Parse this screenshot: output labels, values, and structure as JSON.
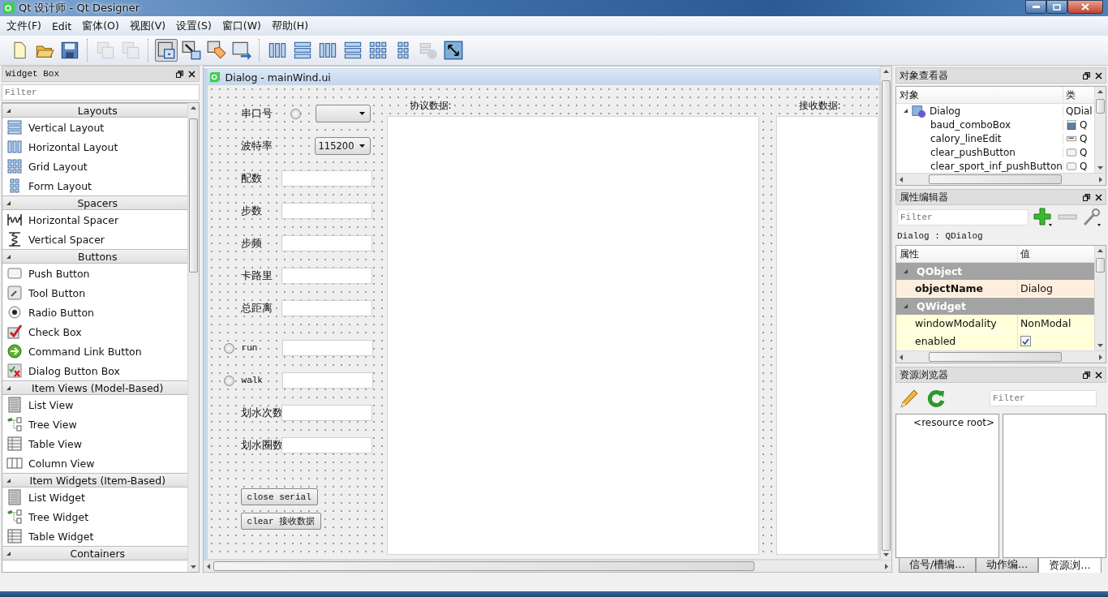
{
  "window": {
    "title": "Qt 设计师 - Qt Designer"
  },
  "menu": [
    "文件(F)",
    "Edit",
    "窗体(O)",
    "视图(V)",
    "设置(S)",
    "窗口(W)",
    "帮助(H)"
  ],
  "toolbar": [
    [
      {
        "kind": "new",
        "disabled": false,
        "selected": false
      },
      {
        "kind": "open",
        "disabled": false,
        "selected": false
      },
      {
        "kind": "save",
        "disabled": false,
        "selected": false
      }
    ],
    [
      {
        "kind": "front",
        "disabled": true,
        "selected": false
      },
      {
        "kind": "back",
        "disabled": true,
        "selected": false
      }
    ],
    [
      {
        "kind": "edit",
        "disabled": false,
        "selected": true
      },
      {
        "kind": "signals",
        "disabled": false,
        "selected": false
      },
      {
        "kind": "buddy",
        "disabled": false,
        "selected": false
      },
      {
        "kind": "taborder",
        "disabled": false,
        "selected": false
      }
    ],
    [
      {
        "kind": "hlayout",
        "disabled": false,
        "selected": false
      },
      {
        "kind": "vlayout",
        "disabled": false,
        "selected": false
      },
      {
        "kind": "hsplit",
        "disabled": false,
        "selected": false
      },
      {
        "kind": "vsplit",
        "disabled": false,
        "selected": false
      },
      {
        "kind": "grid",
        "disabled": false,
        "selected": false
      },
      {
        "kind": "form",
        "disabled": false,
        "selected": false
      },
      {
        "kind": "break",
        "disabled": true,
        "selected": false
      },
      {
        "kind": "adjust",
        "disabled": false,
        "selected": false
      }
    ]
  ],
  "widget_box": {
    "title": "Widget Box",
    "filter_placeholder": "Filter",
    "categories": [
      {
        "name": "Layouts",
        "expanded": true,
        "items": [
          {
            "label": "Vertical Layout",
            "kind": "vlayout"
          },
          {
            "label": "Horizontal Layout",
            "kind": "hlayout"
          },
          {
            "label": "Grid Layout",
            "kind": "grid"
          },
          {
            "label": "Form Layout",
            "kind": "form"
          }
        ]
      },
      {
        "name": "Spacers",
        "expanded": true,
        "items": [
          {
            "label": "Horizontal Spacer",
            "kind": "hspacer"
          },
          {
            "label": "Vertical Spacer",
            "kind": "vspacer"
          }
        ]
      },
      {
        "name": "Buttons",
        "expanded": true,
        "items": [
          {
            "label": "Push Button",
            "kind": "push"
          },
          {
            "label": "Tool Button",
            "kind": "tool"
          },
          {
            "label": "Radio Button",
            "kind": "radio"
          },
          {
            "label": "Check Box",
            "kind": "check"
          },
          {
            "label": "Command Link Button",
            "kind": "commandlink"
          },
          {
            "label": "Dialog Button Box",
            "kind": "buttonbox"
          }
        ]
      },
      {
        "name": "Item Views (Model-Based)",
        "expanded": true,
        "items": [
          {
            "label": "List View",
            "kind": "list"
          },
          {
            "label": "Tree View",
            "kind": "tree"
          },
          {
            "label": "Table View",
            "kind": "table"
          },
          {
            "label": "Column View",
            "kind": "column"
          }
        ]
      },
      {
        "name": "Item Widgets (Item-Based)",
        "expanded": true,
        "items": [
          {
            "label": "List Widget",
            "kind": "list"
          },
          {
            "label": "Tree Widget",
            "kind": "tree"
          },
          {
            "label": "Table Widget",
            "kind": "table"
          }
        ]
      },
      {
        "name": "Containers",
        "expanded": true
      }
    ]
  },
  "form": {
    "title": "Dialog - mainWind.ui",
    "field_groups": [
      [
        {
          "kind": "combo_radio",
          "label": "串口号",
          "radio_checked": false
        },
        {
          "kind": "combo",
          "label": "波特率",
          "value": "115200"
        },
        {
          "kind": "line",
          "label": "配数"
        },
        {
          "kind": "line",
          "label": "步数"
        },
        {
          "kind": "line",
          "label": "步频"
        },
        {
          "kind": "line",
          "label": "卡路里"
        },
        {
          "kind": "line",
          "label": "总距离"
        }
      ],
      [
        {
          "kind": "radio_line",
          "label": "run",
          "radio_checked": false
        },
        {
          "kind": "radio_line",
          "label": "walk",
          "radio_checked": false
        },
        {
          "kind": "line",
          "label": "划水次数"
        },
        {
          "kind": "line",
          "label": "划水圈数"
        }
      ]
    ],
    "buttons": [
      "close serial",
      "clear 接收数据"
    ],
    "protocol_label": "协议数据:",
    "receive_label": "接收数据:"
  },
  "object_inspector": {
    "title": "对象查看器",
    "columns": [
      "对象",
      "类"
    ],
    "tree": [
      {
        "name": "Dialog",
        "class": "QDial",
        "kind": "dialog",
        "expanded": true,
        "children": [
          {
            "name": "baud_comboBox",
            "class": "Q",
            "kind": "combo"
          },
          {
            "name": "calory_lineEdit",
            "class": "Q",
            "kind": "line"
          },
          {
            "name": "clear_pushButton",
            "class": "Q",
            "kind": "push"
          },
          {
            "name": "clear_sport_inf_pushButton",
            "class": "Q",
            "kind": "push"
          }
        ]
      }
    ]
  },
  "property_editor": {
    "title": "属性编辑器",
    "filter_placeholder": "Filter",
    "object": "Dialog : QDialog",
    "columns": [
      "属性",
      "值"
    ],
    "groups": [
      {
        "name": "QObject",
        "expanded": true,
        "color": "#fdeedd",
        "properties": [
          {
            "name": "objectName",
            "kind": "text",
            "value": "Dialog",
            "changed": true
          }
        ]
      },
      {
        "name": "QWidget",
        "expanded": true,
        "color": "#ffffd9",
        "properties": [
          {
            "name": "windowModality",
            "kind": "text",
            "value": "NonModal",
            "changed": false
          },
          {
            "name": "enabled",
            "kind": "check",
            "checked": true,
            "changed": false
          }
        ]
      }
    ]
  },
  "resource_browser": {
    "title": "资源浏览器",
    "filter_placeholder": "Filter",
    "root": "<resource root>"
  },
  "bottom_tabs": [
    {
      "label": "信号/槽编…",
      "selected": false
    },
    {
      "label": "动作编…",
      "selected": false
    },
    {
      "label": "资源浏…",
      "selected": true
    }
  ]
}
